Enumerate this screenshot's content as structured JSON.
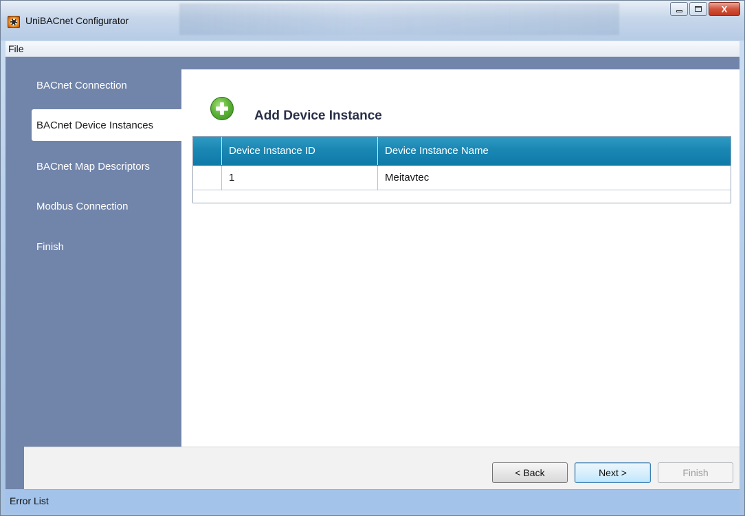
{
  "window": {
    "title": "UniBACnet Configurator",
    "close_label": "X"
  },
  "menu": {
    "file": "File"
  },
  "sidebar": {
    "items": [
      {
        "label": "BACnet Connection",
        "active": false
      },
      {
        "label": "BACnet Device Instances",
        "active": true
      },
      {
        "label": "BACnet Map Descriptors",
        "active": false
      },
      {
        "label": "Modbus Connection",
        "active": false
      },
      {
        "label": "Finish",
        "active": false
      }
    ]
  },
  "main": {
    "section_title": "Add Device Instance",
    "grid": {
      "columns": [
        "",
        "Device Instance ID",
        "Device Instance Name"
      ],
      "rows": [
        {
          "id": "1",
          "name": "Meitavtec"
        }
      ]
    }
  },
  "footer": {
    "back_label": "< Back",
    "next_label": "Next >",
    "finish_label": "Finish"
  },
  "status": {
    "error_list": "Error List"
  },
  "colors": {
    "sidebar": "#7184aa",
    "grid_header": "#1a87b3",
    "add_icon": "#5fb63a",
    "error_bar": "#a3c3ea"
  }
}
